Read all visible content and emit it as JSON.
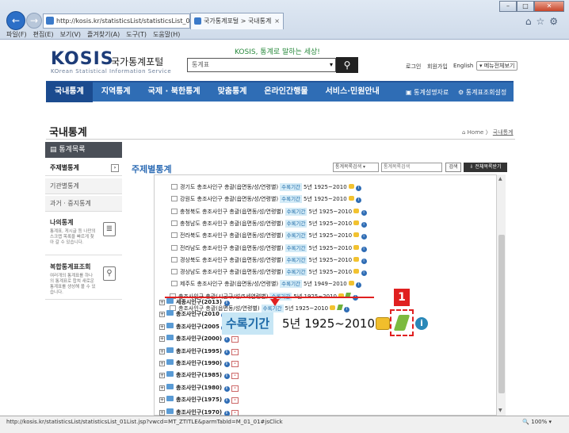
{
  "browser": {
    "address": "http://kosis.kr/statisticsList/statisticsList_0",
    "tab_title": "국가통계포털 > 국내통계",
    "menu": [
      "파일(F)",
      "편집(E)",
      "보기(V)",
      "즐겨찾기(A)",
      "도구(T)",
      "도움말(H)"
    ],
    "status_url": "http://kosis.kr/statisticsList/statisticsList_01List.jsp?vwcd=MT_ZTITLE&parmTabId=M_01_01#jsClick",
    "zoom": "100%"
  },
  "header": {
    "logo": "KOSIS",
    "logo_sub": "국가통계포털",
    "logo_en": "KOrean Statistical Information Service",
    "slogan": "KOSIS, 통계로 말하는 세상!",
    "search_select": "통계표",
    "login": "로그인",
    "join": "회원가입",
    "english": "English",
    "all_menu": "▾ 메뉴전체보기"
  },
  "mainnav": {
    "items": [
      "국내통계",
      "지역통계",
      "국제 · 북한통계",
      "맞춤통계",
      "온라인간행물",
      "서비스·민원안내"
    ],
    "right1": "통계설명자료",
    "right2": "통계표조회설정"
  },
  "page": {
    "title": "국내통계",
    "crumb_home": "Home",
    "crumb_current": "국내통계"
  },
  "sidebar": {
    "head": "통계목록",
    "items": [
      "주제별통계",
      "기관별통계",
      "과거 · 중지통계"
    ],
    "my_title": "나의통계",
    "my_desc": "통계표, 게시글 등 나만의 스크랩 목록을 빠르게 찾아 갈 수 있습니다.",
    "multi_title": "복합통계표조회",
    "multi_desc": "여러개의 통계표를 하나의 통계표로 합쳐 새로운 통계표를 생성해 볼 수 있습니다."
  },
  "content": {
    "title": "주제별통계",
    "select1": "통계목록검색",
    "select2": "통계목록검색",
    "search_btn": "검색",
    "download_btn": "전체목록받기",
    "period_tag": "수록기간",
    "rows": [
      "경기도 총조사인구 총괄(읍면동/성/연령별)",
      "강원도 총조사인구 총괄(읍면동/성/연령별)",
      "충청북도 총조사인구 총괄(읍면동/성/연령별)",
      "충청남도 총조사인구 총괄(읍면동/성/연령별)",
      "전라북도 총조사인구 총괄(읍면동/성/연령별)",
      "전라남도 총조사인구 총괄(읍면동/성/연령별)",
      "경상북도 총조사인구 총괄(읍면동/성/연령별)",
      "경상남도 총조사인구 총괄(읍면동/성/연령별)",
      "제주도 총조사인구 총괄(읍면동/성/연령별)",
      "총조사인구 총괄(시군구/성/5세연령별)",
      "총조사인구 총괄(읍면동/성/연령별)"
    ],
    "periods": [
      "5년 1925~2010",
      "5년 1925~2010",
      "5년 1925~2010",
      "5년 1925~2010",
      "5년 1925~2010",
      "5년 1925~2010",
      "5년 1925~2010",
      "5년 1925~2010",
      "5년 1949~2010",
      "5년 1925~2010",
      "5년 1925~2010"
    ],
    "nodes": [
      "세종시인구(2013)",
      "총조사인구(2010",
      "총조사인구(2005",
      "총조사인구(2000)",
      "총조사인구(1995)",
      "총조사인구(1990)",
      "총조사인구(1985)",
      "총조사인구(1980)",
      "총조사인구(1975)",
      "총조사인구(1970)",
      "총조사인구(1966)"
    ],
    "zoom_tag": "수록기간",
    "zoom_text": "5년  1925~2010",
    "badge": "1"
  }
}
